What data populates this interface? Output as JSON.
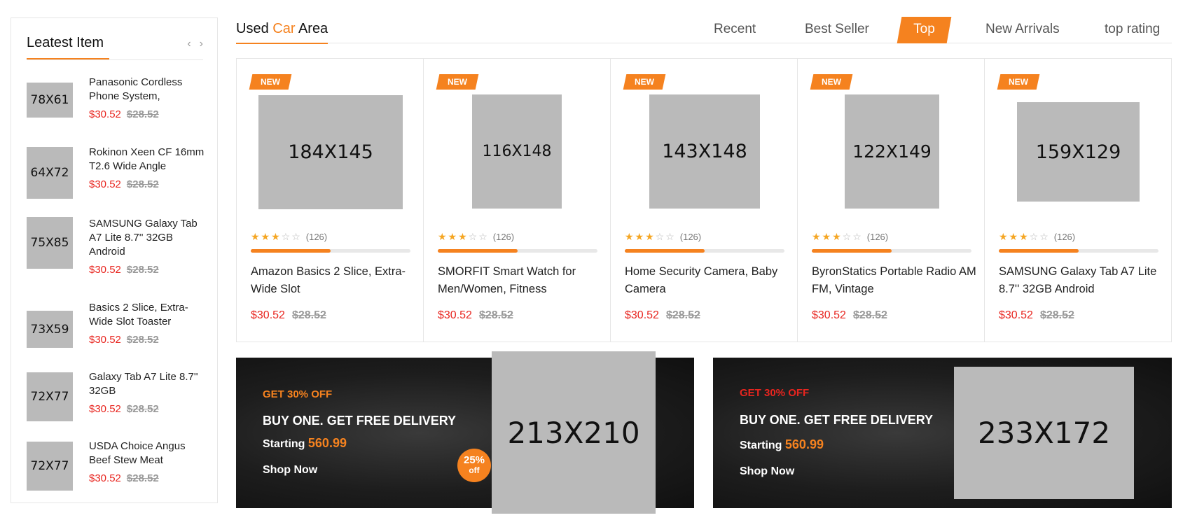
{
  "sidebar": {
    "title": "Leatest Item",
    "prev_icon": "‹",
    "next_icon": "›",
    "items": [
      {
        "thumb": "78X61",
        "name": "Panasonic Cordless Phone System,",
        "price": "$30.52",
        "old_price": "$28.52"
      },
      {
        "thumb": "64X72",
        "name": "Rokinon Xeen CF 16mm T2.6 Wide Angle",
        "price": "$30.52",
        "old_price": "$28.52"
      },
      {
        "thumb": "75X85",
        "name": "SAMSUNG Galaxy Tab A7 Lite 8.7'' 32GB Android",
        "price": "$30.52",
        "old_price": "$28.52"
      },
      {
        "thumb": "73X59",
        "name": "Basics 2 Slice, Extra-Wide Slot Toaster",
        "price": "$30.52",
        "old_price": "$28.52"
      },
      {
        "thumb": "72X77",
        "name": "Galaxy Tab A7 Lite 8.7'' 32GB",
        "price": "$30.52",
        "old_price": "$28.52"
      },
      {
        "thumb": "72X77",
        "name": "USDA Choice Angus Beef Stew Meat",
        "price": "$30.52",
        "old_price": "$28.52"
      }
    ]
  },
  "main": {
    "title_pre": "Used ",
    "title_accent": "Car",
    "title_post": " Area",
    "tabs": [
      {
        "label": "Recent",
        "active": false
      },
      {
        "label": "Best Seller",
        "active": false
      },
      {
        "label": "Top",
        "active": true
      },
      {
        "label": "New Arrivals",
        "active": false
      },
      {
        "label": "top rating",
        "active": false
      }
    ]
  },
  "products": [
    {
      "badge": "NEW",
      "image": "184X145",
      "rating": 3,
      "reviews": "(126)",
      "progress": 0.5,
      "name": "Amazon Basics 2 Slice, Extra-Wide Slot",
      "price": "$30.52",
      "old_price": "$28.52"
    },
    {
      "badge": "NEW",
      "image": "116X148",
      "rating": 3,
      "reviews": "(126)",
      "progress": 0.5,
      "name": "SMORFIT Smart Watch for Men/Women, Fitness",
      "price": "$30.52",
      "old_price": "$28.52"
    },
    {
      "badge": "NEW",
      "image": "143X148",
      "rating": 3,
      "reviews": "(126)",
      "progress": 0.5,
      "name": "Home Security Camera, Baby Camera",
      "price": "$30.52",
      "old_price": "$28.52"
    },
    {
      "badge": "NEW",
      "image": "122X149",
      "rating": 3,
      "reviews": "(126)",
      "progress": 0.5,
      "name": "ByronStatics Portable Radio AM FM, Vintage",
      "price": "$30.52",
      "old_price": "$28.52"
    },
    {
      "badge": "NEW",
      "image": "159X129",
      "rating": 3,
      "reviews": "(126)",
      "progress": 0.5,
      "name": "SAMSUNG Galaxy Tab A7 Lite 8.7'' 32GB Android",
      "price": "$30.52",
      "old_price": "$28.52"
    }
  ],
  "banners": [
    {
      "offer": "GET 30% OFF",
      "offer_color": "#f5821f",
      "headline": "BUY ONE. GET FREE DELIVERY",
      "starting_label": "Starting",
      "starting_price": "560.99",
      "cta": "Shop Now",
      "image": "213X210",
      "discount_pct": "25%",
      "discount_word": "off"
    },
    {
      "offer": "GET 30% OFF",
      "offer_color": "#e8251f",
      "headline": "BUY ONE. GET FREE DELIVERY",
      "starting_label": "Starting",
      "starting_price": "560.99",
      "cta": "Shop Now",
      "image": "233X172"
    }
  ],
  "colors": {
    "accent": "#f5821f",
    "price_red": "#e8251f",
    "placeholder": "#bababa"
  }
}
